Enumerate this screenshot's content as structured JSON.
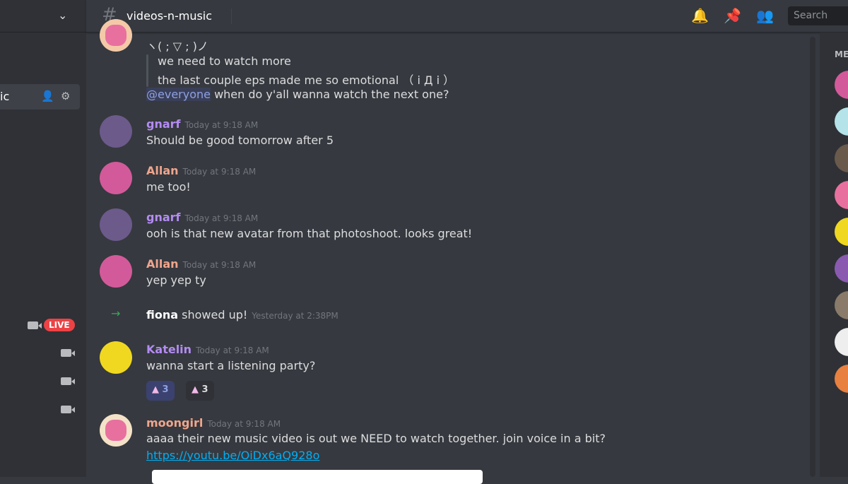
{
  "channel": {
    "name": "videos-n-music",
    "selected_label": "ic",
    "live_label": "LIVE"
  },
  "header": {
    "search_placeholder": "Search",
    "icons": [
      "bell-icon",
      "pin-icon",
      "members-icon"
    ]
  },
  "members": {
    "title": "ME"
  },
  "messages": [
    {
      "lines": [
        "ヽ( ; ▽ ; )ノ",
        "we need to watch more",
        "the last couple eps made me so emotional （ i Д i ）"
      ],
      "mention": "@everyone",
      "text": "when do y'all wanna watch the next one?"
    },
    {
      "author": "gnarf",
      "color": "#b38cf2",
      "time": "Today at 9:18 AM",
      "text": "Should be good tomorrow after 5"
    },
    {
      "author": "Allan",
      "color": "#f0a58c",
      "time": "Today at 9:18 AM",
      "text": "me too!"
    },
    {
      "author": "gnarf",
      "color": "#b38cf2",
      "time": "Today at 9:18 AM",
      "text": "ooh is that new avatar from that photoshoot. looks great!"
    },
    {
      "author": "Allan",
      "color": "#f0a58c",
      "time": "Today at 9:18 AM",
      "text": "yep yep ty"
    },
    {
      "system": true,
      "author": "fiona",
      "text": "showed up!",
      "time": "Yesterday at 2:38PM"
    },
    {
      "author": "Katelin",
      "color": "#b38cf2",
      "time": "Today at 9:18 AM",
      "text": "wanna start a listening party?",
      "reactions": [
        {
          "count": "3",
          "active": true
        },
        {
          "count": "3",
          "active": false
        }
      ]
    },
    {
      "author": "moongirl",
      "color": "#f0a58c",
      "time": "Today at 9:18 AM",
      "text": "aaaa their new music video is out we NEED to watch together. join voice in a bit?",
      "link": "https://youtu.be/OiDx6aQ928o"
    }
  ]
}
